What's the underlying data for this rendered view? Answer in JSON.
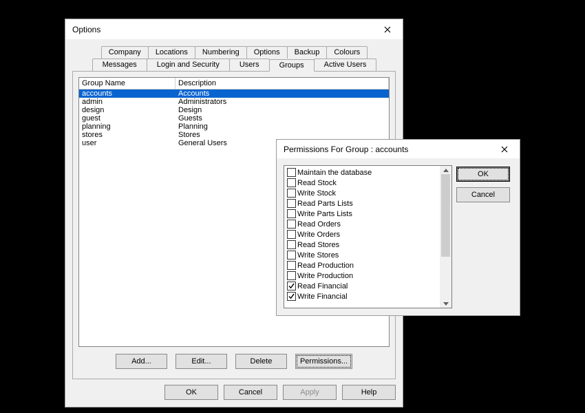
{
  "options": {
    "title": "Options",
    "tabsRow1": [
      "Company",
      "Locations",
      "Numbering",
      "Options",
      "Backup",
      "Colours"
    ],
    "tabsRow2": [
      "Messages",
      "Login and Security",
      "Users",
      "Groups",
      "Active Users"
    ],
    "activeTab": "Groups",
    "columns": {
      "name": "Group Name",
      "desc": "Description"
    },
    "groups": [
      {
        "name": "accounts",
        "desc": "Accounts",
        "selected": true
      },
      {
        "name": "admin",
        "desc": "Administrators"
      },
      {
        "name": "design",
        "desc": "Design"
      },
      {
        "name": "guest",
        "desc": "Guests"
      },
      {
        "name": "planning",
        "desc": "Planning"
      },
      {
        "name": "stores",
        "desc": "Stores"
      },
      {
        "name": "user",
        "desc": "General Users"
      }
    ],
    "buttons": {
      "add": "Add...",
      "edit": "Edit...",
      "delete": "Delete",
      "permissions": "Permissions..."
    },
    "dialogButtons": {
      "ok": "OK",
      "cancel": "Cancel",
      "apply": "Apply",
      "help": "Help"
    }
  },
  "perm": {
    "title": "Permissions For Group : accounts",
    "items": [
      {
        "label": "Maintain the database",
        "checked": false
      },
      {
        "label": "Read Stock",
        "checked": false
      },
      {
        "label": "Write Stock",
        "checked": false
      },
      {
        "label": "Read Parts Lists",
        "checked": false
      },
      {
        "label": "Write Parts Lists",
        "checked": false
      },
      {
        "label": "Read Orders",
        "checked": false
      },
      {
        "label": "Write Orders",
        "checked": false
      },
      {
        "label": "Read Stores",
        "checked": false
      },
      {
        "label": "Write Stores",
        "checked": false
      },
      {
        "label": "Read Production",
        "checked": false
      },
      {
        "label": "Write Production",
        "checked": false
      },
      {
        "label": "Read Financial",
        "checked": true
      },
      {
        "label": "Write Financial",
        "checked": true
      }
    ],
    "buttons": {
      "ok": "OK",
      "cancel": "Cancel"
    }
  }
}
